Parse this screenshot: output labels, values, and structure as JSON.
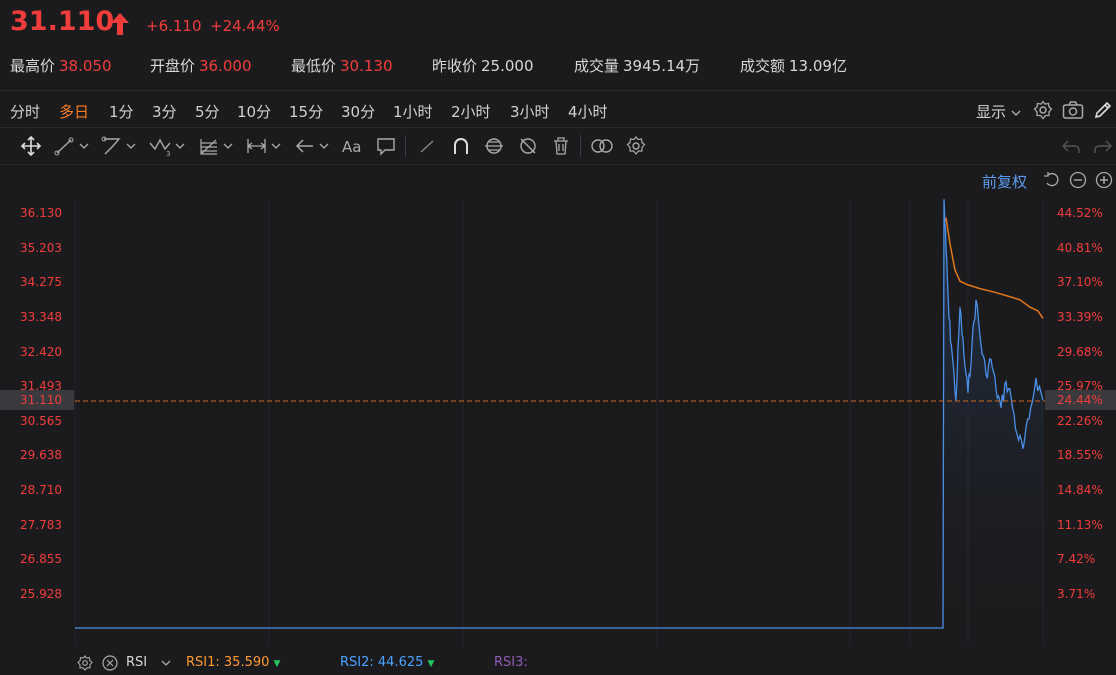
{
  "header": {
    "price": "31.110",
    "change": "+6.110",
    "change_pct": "+24.44%",
    "stats": [
      {
        "label": "最高价",
        "value": "38.050",
        "color": "#f23d3d"
      },
      {
        "label": "开盘价",
        "value": "36.000",
        "color": "#f23d3d"
      },
      {
        "label": "最低价",
        "value": "30.130",
        "color": "#f23d3d"
      },
      {
        "label": "昨收价",
        "value": "25.000",
        "color": "#d8d8d8"
      },
      {
        "label": "成交量",
        "value": "3945.14万",
        "color": "#d8d8d8"
      },
      {
        "label": "成交额",
        "value": "13.09亿",
        "color": "#d8d8d8"
      }
    ]
  },
  "timeframes": [
    "分时",
    "多日",
    "1分",
    "3分",
    "5分",
    "10分",
    "15分",
    "30分",
    "1小时",
    "2小时",
    "3小时",
    "4小时"
  ],
  "active_timeframe": "多日",
  "toolbar_right": {
    "display_label": "显示"
  },
  "adjust_label": "前复权",
  "y_axis_left": [
    "36.130",
    "35.203",
    "34.275",
    "33.348",
    "32.420",
    "31.493",
    "30.565",
    "29.638",
    "28.710",
    "27.783",
    "26.855",
    "25.928"
  ],
  "y_axis_right": [
    "44.52%",
    "40.81%",
    "37.10%",
    "33.39%",
    "29.68%",
    "25.97%",
    "22.26%",
    "18.55%",
    "14.84%",
    "11.13%",
    "7.42%",
    "3.71%"
  ],
  "current_price_tag": "31.110",
  "current_pct_tag": "24.44%",
  "rsi": {
    "label": "RSI",
    "rsi1": "RSI1: 35.590",
    "rsi2": "RSI2: 44.625",
    "rsi3": "RSI3:",
    "colors": {
      "rsi1": "#ff9a2e",
      "rsi2": "#4aa3ff",
      "rsi3": "#8e5bb5"
    }
  },
  "chart_data": {
    "type": "line",
    "series": [
      {
        "values": [
          25.0,
          25.0,
          25.0,
          25.0,
          25.0,
          36.5,
          35.2,
          33.3,
          32.4,
          31.1,
          33.6,
          32.3,
          31.3,
          32.6,
          33.8,
          32.6,
          31.8,
          32.2,
          31.4,
          30.9,
          31.6,
          31.2,
          30.2,
          29.8,
          30.6,
          31.7,
          31.1
        ]
      },
      {
        "values": [
          36.0,
          35.3,
          34.6,
          34.3,
          34.2,
          34.1,
          34.0,
          33.9,
          33.8,
          33.6,
          33.5,
          33.3
        ]
      }
    ],
    "ylim": [
      25.0,
      36.6
    ]
  },
  "colors": {
    "up": "#f23d3d",
    "price_line": "#4a8fe8",
    "avg_line": "#e0781c",
    "accent": "#ff7d1a",
    "link": "#5b9cf0"
  },
  "icons": {
    "settings": "gear-icon",
    "screenshot": "camera-icon",
    "draw": "pencil-icon"
  }
}
